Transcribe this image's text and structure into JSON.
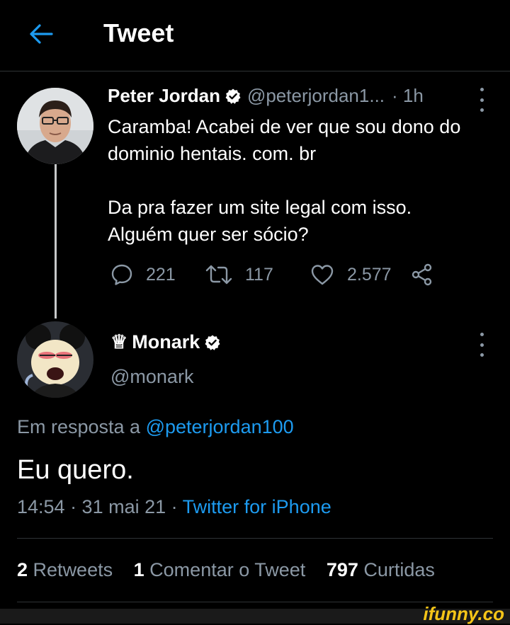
{
  "header": {
    "title": "Tweet",
    "back_icon": "arrow-left-icon"
  },
  "tweet1": {
    "author_name": "Peter Jordan",
    "handle": "@peterjordan1...",
    "time": "· 1h",
    "line1": "Caramba! Acabei de ver que sou dono do",
    "line2": "dominio hentais. com. br",
    "line3": "Da pra fazer um site legal com isso.",
    "line4": "Alguém quer ser sócio?",
    "replies": "221",
    "retweets": "117",
    "likes": "2.577"
  },
  "tweet2": {
    "crown": "♕",
    "author_name": "Monark",
    "handle": "@monark",
    "reply_prefix": "Em resposta a",
    "reply_handle": "@peterjordan100",
    "text": "Eu quero.",
    "time": "14:54 · 31 mai 21 ·",
    "source": "Twitter for iPhone",
    "retweets_count": "2",
    "retweets_label": "Retweets",
    "quote_count": "1",
    "quote_label": "Comentar o Tweet",
    "likes_count": "797",
    "likes_label": "Curtidas"
  },
  "watermark": "ifunny.co",
  "colors": {
    "accent": "#1d9bf0",
    "muted": "#8b98a5",
    "background": "#000000"
  }
}
